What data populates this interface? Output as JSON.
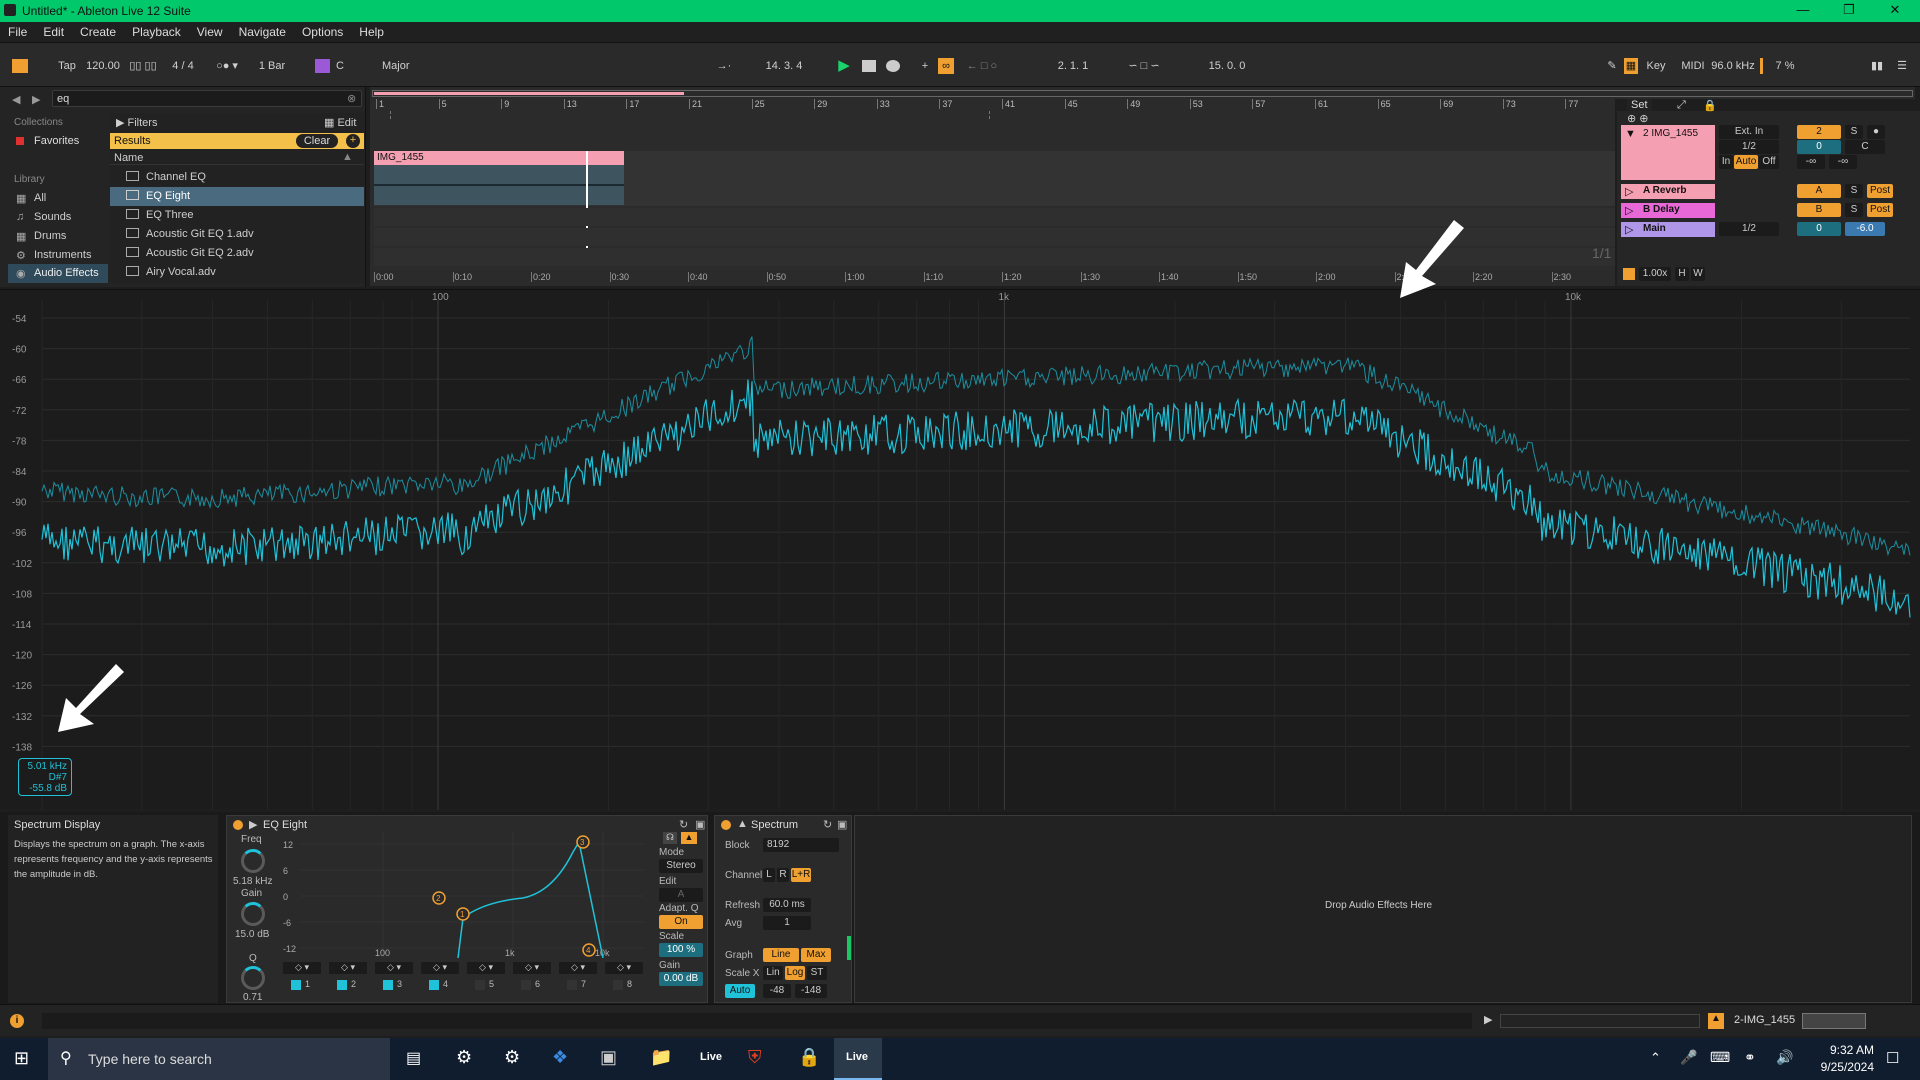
{
  "window": {
    "title": "Untitled* - Ableton Live 12 Suite"
  },
  "menu": [
    "File",
    "Edit",
    "Create",
    "Playback",
    "View",
    "Navigate",
    "Options",
    "Help"
  ],
  "control": {
    "tap": "Tap",
    "tempo": "120.00",
    "signature": "4 / 4",
    "quantize": "1 Bar",
    "key": "C",
    "scale": "Major",
    "position": "14.  3.  4",
    "loop_start": "2.  1.  1",
    "loop_length": "15.  0.  0",
    "key_label": "Key",
    "midi_label": "MIDI",
    "sample_rate": "96.0 kHz",
    "cpu": "7 %"
  },
  "browser": {
    "search": "eq",
    "collections_label": "Collections",
    "favorites": "Favorites",
    "library_label": "Library",
    "library_items": [
      "All",
      "Sounds",
      "Drums",
      "Instruments",
      "Audio Effects"
    ],
    "filters": "Filters",
    "edit": "Edit",
    "results": "Results",
    "clear": "Clear",
    "name_header": "Name",
    "items": [
      "Channel EQ",
      "EQ Eight",
      "EQ Three",
      "Acoustic Git EQ 1.adv",
      "Acoustic Git EQ 2.adv",
      "Airy Vocal.adv"
    ]
  },
  "arrangement": {
    "bar_ruler": [
      "1",
      "5",
      "9",
      "13",
      "17",
      "21",
      "25",
      "29",
      "33",
      "37",
      "41",
      "45",
      "49",
      "53",
      "57",
      "61",
      "65",
      "69",
      "73",
      "77"
    ],
    "time_ruler": [
      "0:00",
      "0:10",
      "0:20",
      "0:30",
      "0:40",
      "0:50",
      "1:00",
      "1:10",
      "1:20",
      "1:30",
      "1:40",
      "1:50",
      "2:00",
      "2:10",
      "2:20",
      "2:30"
    ],
    "clip_name": "IMG_1455",
    "page": "1/1"
  },
  "mixer": {
    "set": "Set",
    "tracks": [
      {
        "name": "2 IMG_1455",
        "input": "Ext. In",
        "channel": "1/2",
        "number": "2",
        "vol": "0",
        "pan": "C",
        "in": "In",
        "auto": "Auto",
        "off": "Off",
        "inf1": "-∞",
        "inf2": "-∞",
        "s": "S"
      },
      {
        "name": "A Reverb",
        "send": "A",
        "s": "S",
        "post": "Post"
      },
      {
        "name": "B Delay",
        "send": "B",
        "s": "S",
        "post": "Post"
      },
      {
        "name": "Main",
        "channel": "1/2",
        "vol": "0",
        "gain": "-6.0"
      }
    ],
    "zoom": "1.00x",
    "h": "H",
    "w": "W"
  },
  "spectrum": {
    "x_labels": [
      "100",
      "1k",
      "10k"
    ],
    "y_labels": [
      "-54",
      "-60",
      "-66",
      "-72",
      "-78",
      "-84",
      "-90",
      "-96",
      "-102",
      "-108",
      "-114",
      "-120",
      "-126",
      "-132",
      "-138"
    ],
    "readout": {
      "freq": "5.01 kHz",
      "note": "D#7",
      "db": "-55.8 dB"
    }
  },
  "info": {
    "title": "Spectrum Display",
    "text": "Displays the spectrum on a graph. The x-axis represents frequency and the y-axis represents the amplitude in dB."
  },
  "eq": {
    "title": "EQ Eight",
    "freq_label": "Freq",
    "freq": "5.18 kHz",
    "gain_label": "Gain",
    "gain": "15.0 dB",
    "q_label": "Q",
    "q": "0.71",
    "y_labels": [
      "12",
      "6",
      "0",
      "-6",
      "-12"
    ],
    "x_labels": [
      "100",
      "1k",
      "10k"
    ],
    "mode_label": "Mode",
    "mode": "Stereo",
    "edit_label": "Edit",
    "edit_val": "A",
    "adapt_label": "Adapt. Q",
    "adapt": "On",
    "scale_label": "Scale",
    "scale": "100 %",
    "gain2_label": "Gain",
    "gain2": "0.00 dB",
    "bands": [
      "1",
      "2",
      "3",
      "4",
      "5",
      "6",
      "7",
      "8"
    ]
  },
  "spec_dev": {
    "title": "Spectrum",
    "block_label": "Block",
    "block": "8192",
    "channel_label": "Channel",
    "ch": [
      "L",
      "R",
      "L+R"
    ],
    "refresh_label": "Refresh",
    "refresh": "60.0 ms",
    "avg_label": "Avg",
    "avg": "1",
    "graph_label": "Graph",
    "graph": [
      "Line",
      "Max"
    ],
    "scalex_label": "Scale X",
    "scalex": [
      "Lin",
      "Log",
      "ST"
    ],
    "auto": "Auto",
    "range_lo": "-48",
    "range_hi": "-148"
  },
  "drop": "Drop Audio Effects Here",
  "status": {
    "track": "2-IMG_1455"
  },
  "taskbar": {
    "search": "Type here to search",
    "time": "9:32 AM",
    "date": "9/25/2024"
  },
  "colors": {
    "accent": "#f0a030",
    "cyan": "#1fc2d8",
    "clip": "#f59fb2",
    "titlebar": "#00c86b"
  }
}
